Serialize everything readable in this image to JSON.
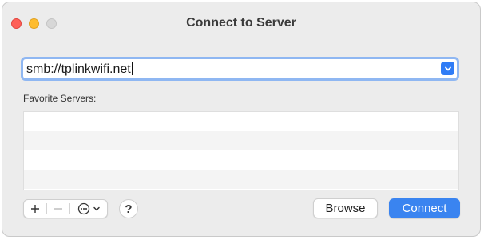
{
  "window": {
    "title": "Connect to Server"
  },
  "address": {
    "value": "smb://tplinkwifi.net",
    "dropdown_icon": "chevron-down-icon"
  },
  "favorites": {
    "label": "Favorite Servers:",
    "items": []
  },
  "toolbar": {
    "add_icon": "plus-icon",
    "remove_icon": "minus-icon",
    "more_icon": "ellipsis-circle-icon",
    "help_label": "?"
  },
  "buttons": {
    "browse_label": "Browse",
    "connect_label": "Connect"
  },
  "colors": {
    "accent": "#3a84f0",
    "focus_ring": "#8fb7f2",
    "close": "#fe5f57",
    "minimize": "#febc2e",
    "zoom_disabled": "#d7d7d7"
  }
}
